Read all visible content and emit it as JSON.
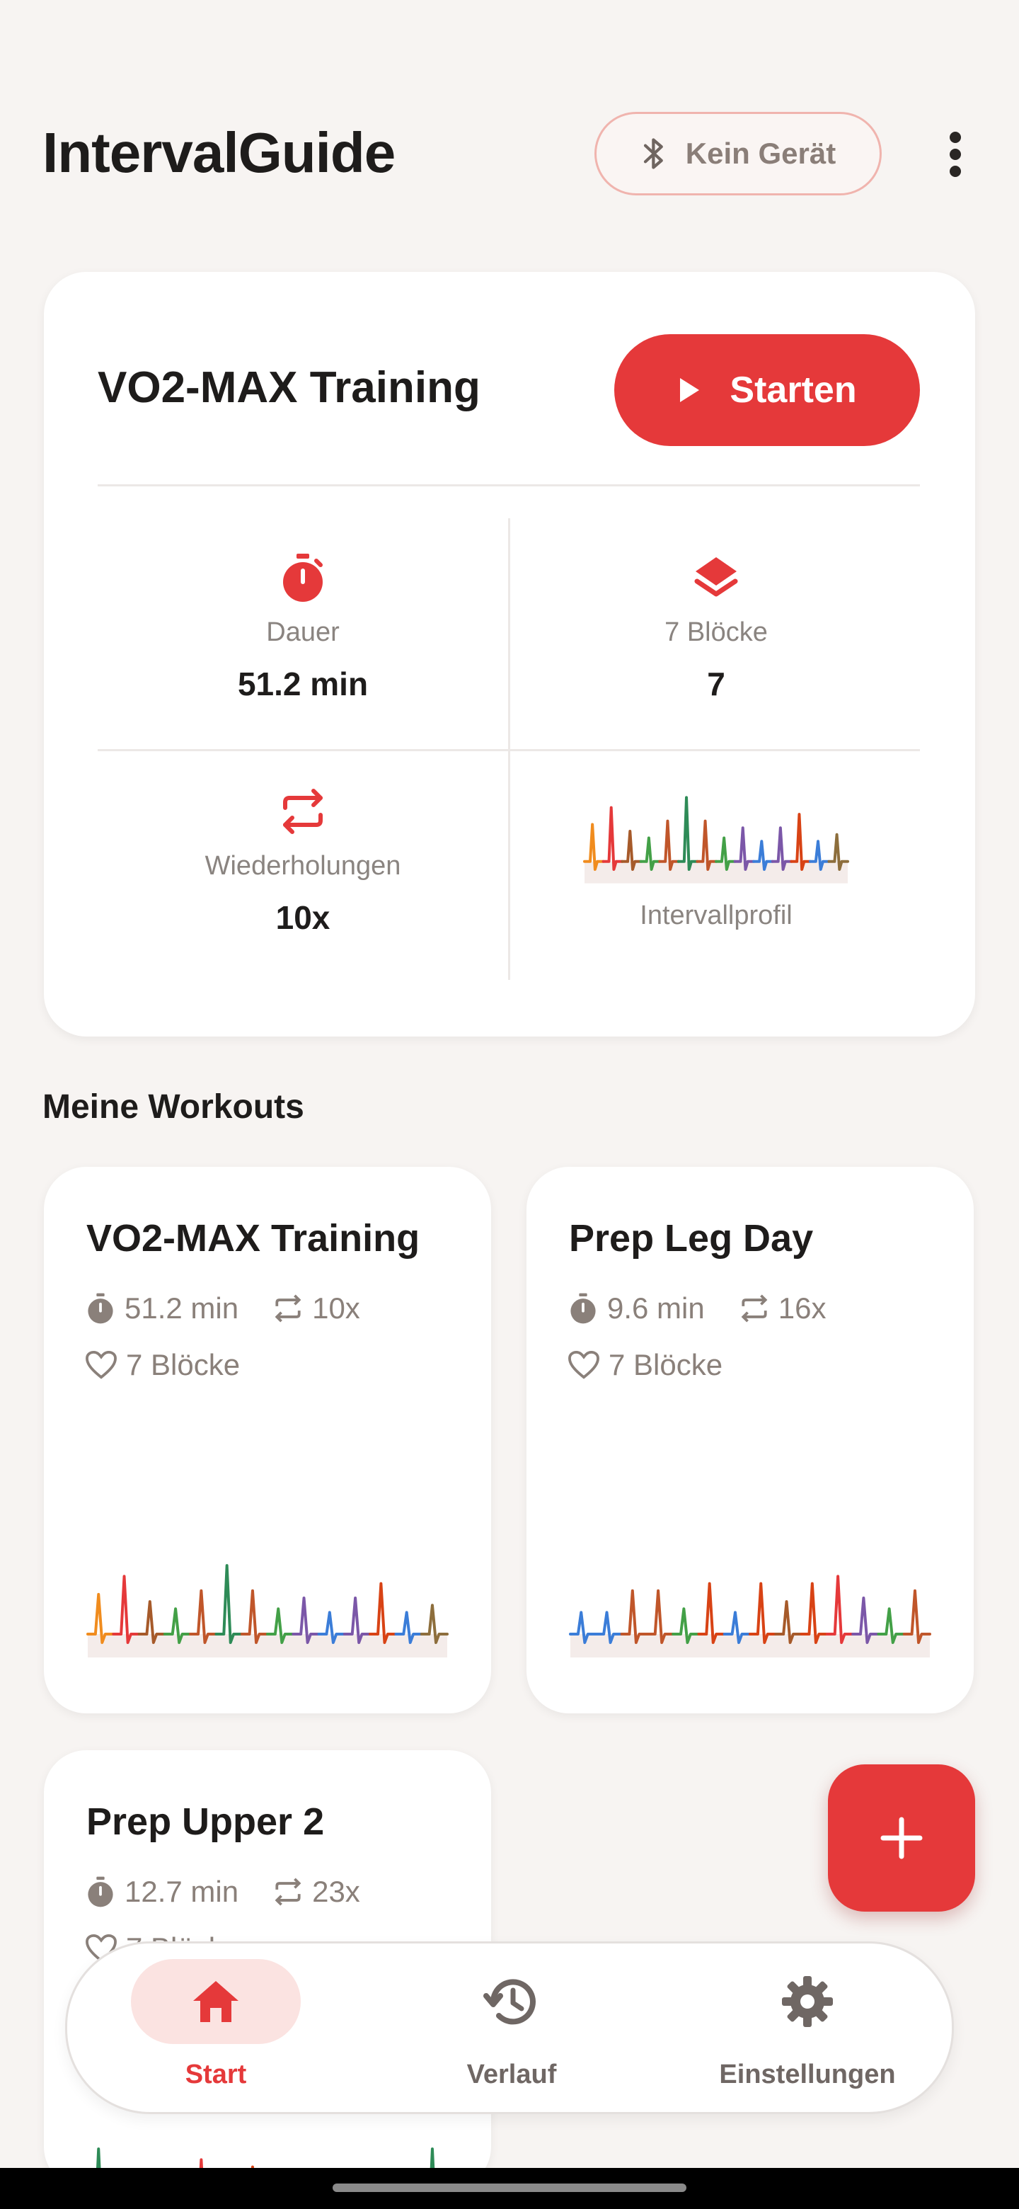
{
  "header": {
    "title": "IntervalGuide",
    "device_label": "Kein Gerät"
  },
  "featured": {
    "title": "VO2-MAX Training",
    "start_label": "Starten",
    "stats": {
      "duration_label": "Dauer",
      "duration_value": "51.2 min",
      "blocks_label": "7 Blöcke",
      "blocks_value": "7",
      "reps_label": "Wiederholungen",
      "reps_value": "10x",
      "profile_label": "Intervallprofil"
    }
  },
  "section_title": "Meine Workouts",
  "workouts": [
    {
      "title": "VO2-MAX Training",
      "duration": "51.2 min",
      "reps": "10x",
      "blocks": "7 Blöcke"
    },
    {
      "title": "Prep Leg Day",
      "duration": "9.6 min",
      "reps": "16x",
      "blocks": "7 Blöcke"
    },
    {
      "title": "Prep Upper 2",
      "duration": "12.7 min",
      "reps": "23x",
      "blocks": "7 Blöcke"
    }
  ],
  "nav": {
    "items": [
      {
        "label": "Start",
        "icon": "home-icon",
        "active": true
      },
      {
        "label": "Verlauf",
        "icon": "history-icon",
        "active": false
      },
      {
        "label": "Einstellungen",
        "icon": "gear-icon",
        "active": false
      }
    ]
  },
  "colors": {
    "accent": "#e5393a",
    "accent_light": "#fbe3e1",
    "muted_text": "#8a807a",
    "background": "#f7f4f2"
  }
}
